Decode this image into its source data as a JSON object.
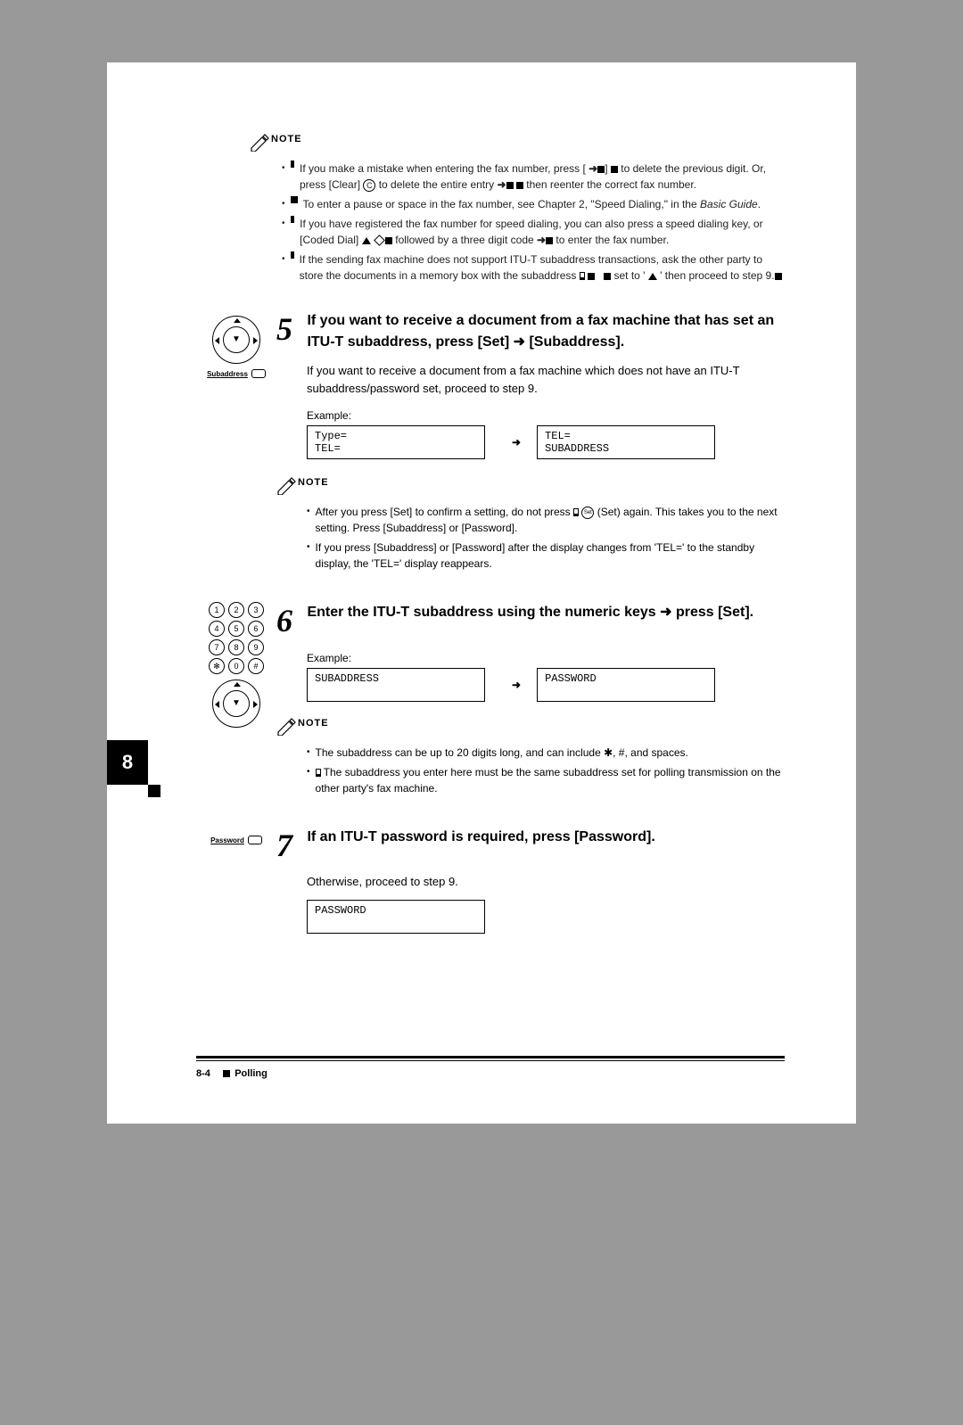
{
  "side_tab": "8",
  "top_note_label": "NOTE",
  "top_notes": {
    "b1_a": "If you make a mistake when entering the fax number, press [",
    "b1_b": "]",
    "b1_c": "to delete the previous digit. Or, press [Clear]",
    "b1_d": "to delete the entire entry",
    "b1_e": "then reenter the correct fax number.",
    "b2_a": "To enter a pause or space in the fax number, see Chapter 2, \"Speed Dialing,\" in the",
    "b2_b": "Basic Guide",
    "b3_a": "If you have registered the fax number for speed dialing, you can also press a speed dialing key, or [Coded Dial]",
    "b3_b": "followed by a three digit code",
    "b3_c": "to enter the fax number.",
    "b4_a": "If the sending fax machine does not support ITU-T subaddress transactions, ask the other party to store the documents in a memory box with the subaddress",
    "b4_b": "set to '",
    "b4_c": "' then proceed to step 9."
  },
  "step5": {
    "title_a": "If you want to receive a document from a fax machine that has set an ITU-T subaddress, press [Set]",
    "title_b": "[Subaddress].",
    "desc": "If you want to receive a document from a fax machine which does not have an ITU-T subaddress/password set, proceed to step 9.",
    "icon_label": "Subaddress",
    "ex_label": "Example:",
    "lcd1_l1": "Type=",
    "lcd1_l2": "TEL=",
    "lcd2_l1": "TEL=",
    "lcd2_l2": "SUBADDRESS"
  },
  "mid_note_label": "NOTE",
  "mid_notes": {
    "n1_a": "After you press [Set] to con",
    "n1_b": "firm a setting, do not press",
    "n1_c": "(Set) again. This takes you",
    "n1_d": "to the next setting. Press [Subaddress] or [Password].",
    "n2_a": "If you press [Subaddress] or [Password] after the display changes from",
    "n2_b": "'TEL='",
    "n2_c": "to the",
    "n2_d": "standby display, the",
    "n2_e": "'TEL='",
    "n2_f": "display reappears."
  },
  "step6": {
    "title_a": "Enter the ITU-T subaddress using the numeric keys",
    "title_b": "press [Set].",
    "ex_label": "Example:",
    "lcd1_l1": "SUBADDRESS",
    "lcd2_l1": "PASSWORD"
  },
  "bot_note_label": "NOTE",
  "bot_notes": {
    "n1_a": "The subaddress can be up to 20 digits long, and can include",
    "n1_b": ", #, and spaces.",
    "n2_a": "The subaddress you enter here must be the same subaddress set for polling transmission on the other party's fax machine."
  },
  "step7": {
    "title": "If an ITU-T password is required, press [Password].",
    "desc": "Otherwise, proceed to step 9.",
    "icon_label": "Password",
    "lcd_l1": "PASSWORD"
  },
  "footer_page": "8-4",
  "footer_text": "Polling"
}
